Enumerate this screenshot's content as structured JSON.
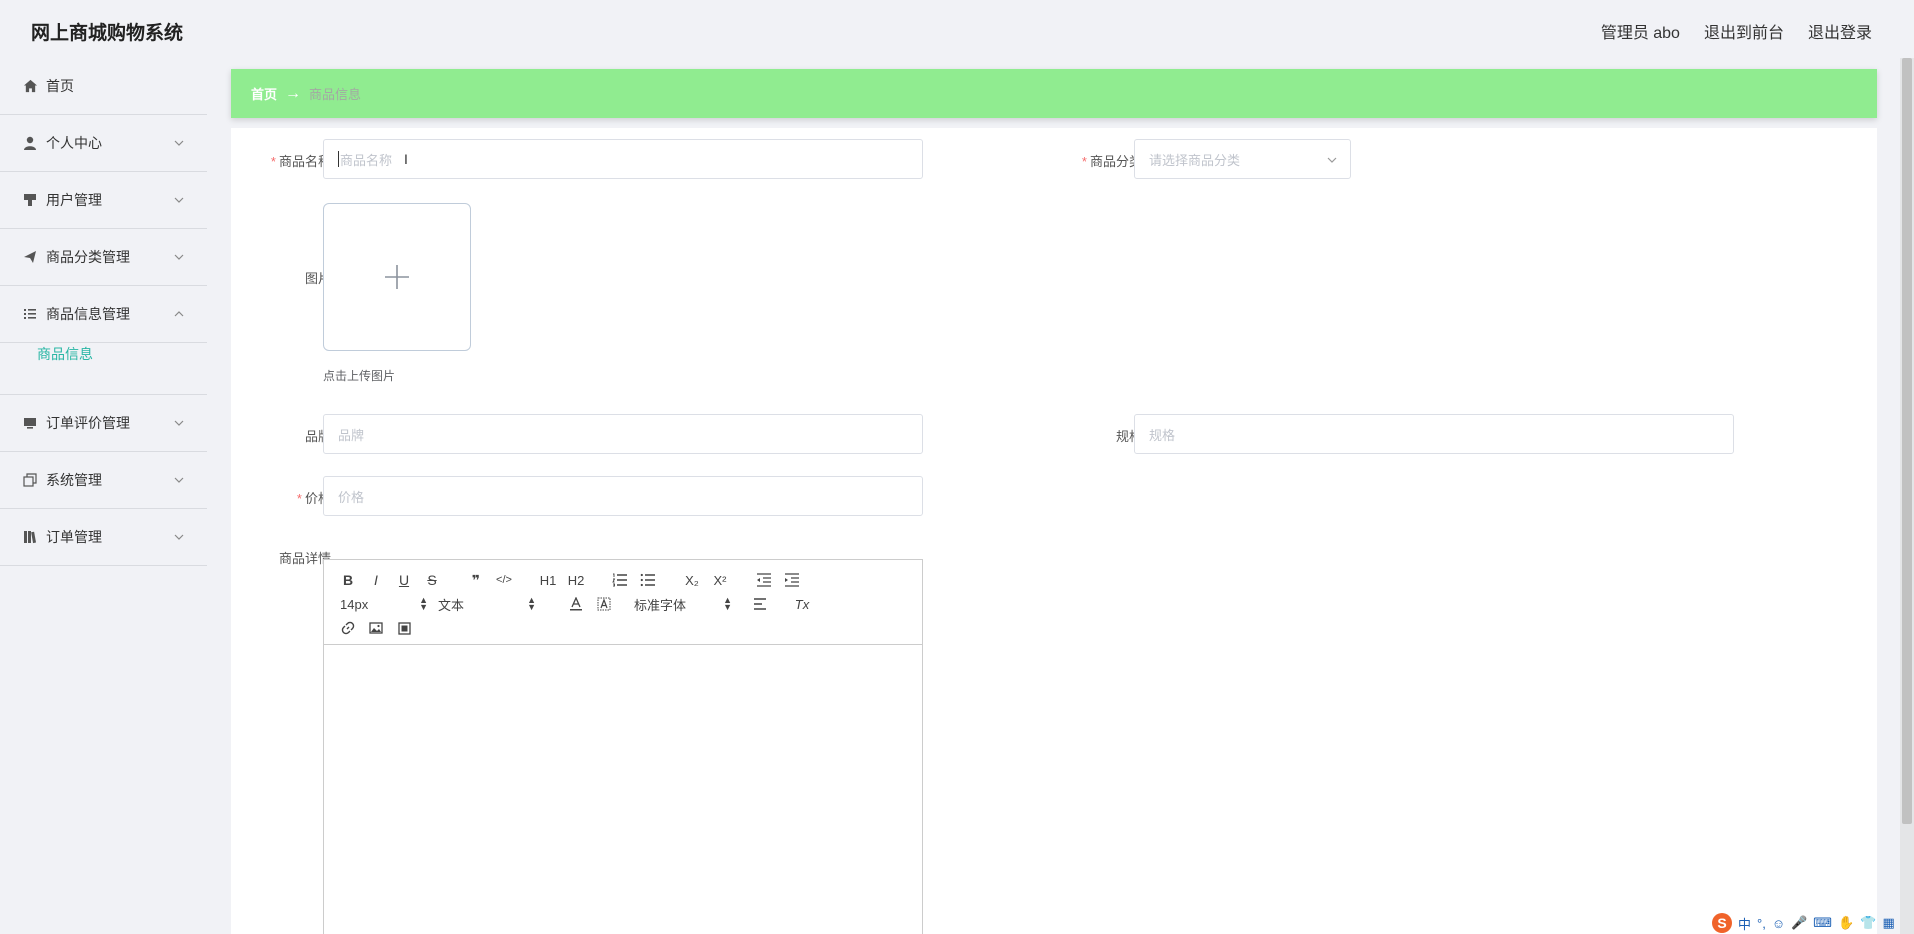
{
  "header": {
    "title": "网上商城购物系统",
    "admin_label": "管理员 abo",
    "front_label": "退出到前台",
    "logout_label": "退出登录"
  },
  "sidebar": {
    "items": [
      {
        "label": "首页",
        "icon": "home-icon"
      },
      {
        "label": "个人中心",
        "icon": "user-icon"
      },
      {
        "label": "用户管理",
        "icon": "brush-icon"
      },
      {
        "label": "商品分类管理",
        "icon": "send-icon"
      },
      {
        "label": "商品信息管理",
        "icon": "list-icon"
      },
      {
        "label": "订单评价管理",
        "icon": "monitor-icon"
      },
      {
        "label": "系统管理",
        "icon": "copy-icon"
      },
      {
        "label": "订单管理",
        "icon": "book-icon"
      }
    ],
    "submenu": {
      "label": "商品信息"
    }
  },
  "breadcrumb": {
    "home": "首页",
    "arrow": "→",
    "current": "商品信息"
  },
  "form": {
    "name": {
      "label": "商品名称",
      "placeholder": "商品名称"
    },
    "category": {
      "label": "商品分类",
      "placeholder": "请选择商品分类"
    },
    "image": {
      "label": "图片",
      "plus": "+",
      "tip": "点击上传图片"
    },
    "brand": {
      "label": "品牌",
      "placeholder": "品牌"
    },
    "spec": {
      "label": "规格",
      "placeholder": "规格"
    },
    "price": {
      "label": "价格",
      "placeholder": "价格"
    },
    "detail": {
      "label": "商品详情"
    },
    "required_mark": "*"
  },
  "editor": {
    "bold": "B",
    "italic": "I",
    "underline": "U",
    "strike": "S",
    "quote": "❞",
    "code": "</>",
    "h1": "H1",
    "h2": "H2",
    "sub": "X₂",
    "sup": "X²",
    "font_size": "14px",
    "header_picker": "文本",
    "font_family": "标准字体",
    "clear": "Tx"
  },
  "ime": {
    "logo": "S",
    "mode": "中"
  },
  "colors": {
    "accent": "#28b6a4",
    "breadcrumb_bg": "#90ec90",
    "required": "#f56c6c"
  }
}
